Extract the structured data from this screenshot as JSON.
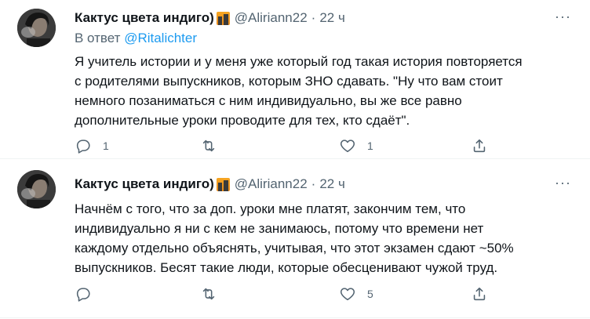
{
  "tweets": [
    {
      "author_name": "Кактус цвета индиго)",
      "handle": "@Aliriann22",
      "separator": "·",
      "time": "22 ч",
      "reply_prefix": "В ответ",
      "reply_to": "@Ritalichter",
      "text": "Я учитель истории и у меня уже который год такая история повторяется\nс родителями выпускников, которым ЗНО сдавать. \"Ну что вам стоит\nнемного позаниматься с ним индивидуально, вы же все равно\nдополнительные уроки проводите для тех, кто сдаёт\".",
      "replies": "1",
      "retweets": "",
      "likes": "1"
    },
    {
      "author_name": "Кактус цвета индиго)",
      "handle": "@Aliriann22",
      "separator": "·",
      "time": "22 ч",
      "text": "Начнём с того, что за доп. уроки мне платят, закончим тем, что\nиндивидуально я ни с кем не занимаюсь, потому что времени нет\nкаждому отдельно объяснять, учитывая, что этот  экзамен сдают ~50%\nвыпускников. Бесят такие люди, которые обесценивают чужой труд.",
      "replies": "",
      "retweets": "",
      "likes": "5"
    }
  ],
  "icons": {
    "reply": "reply-icon",
    "retweet": "retweet-icon",
    "like": "heart-icon",
    "share": "share-icon",
    "more": "more-icon",
    "emoji": "city-emoji-icon"
  },
  "colors": {
    "link": "#1d9bf0",
    "muted": "#536471",
    "text": "#0f1419"
  }
}
